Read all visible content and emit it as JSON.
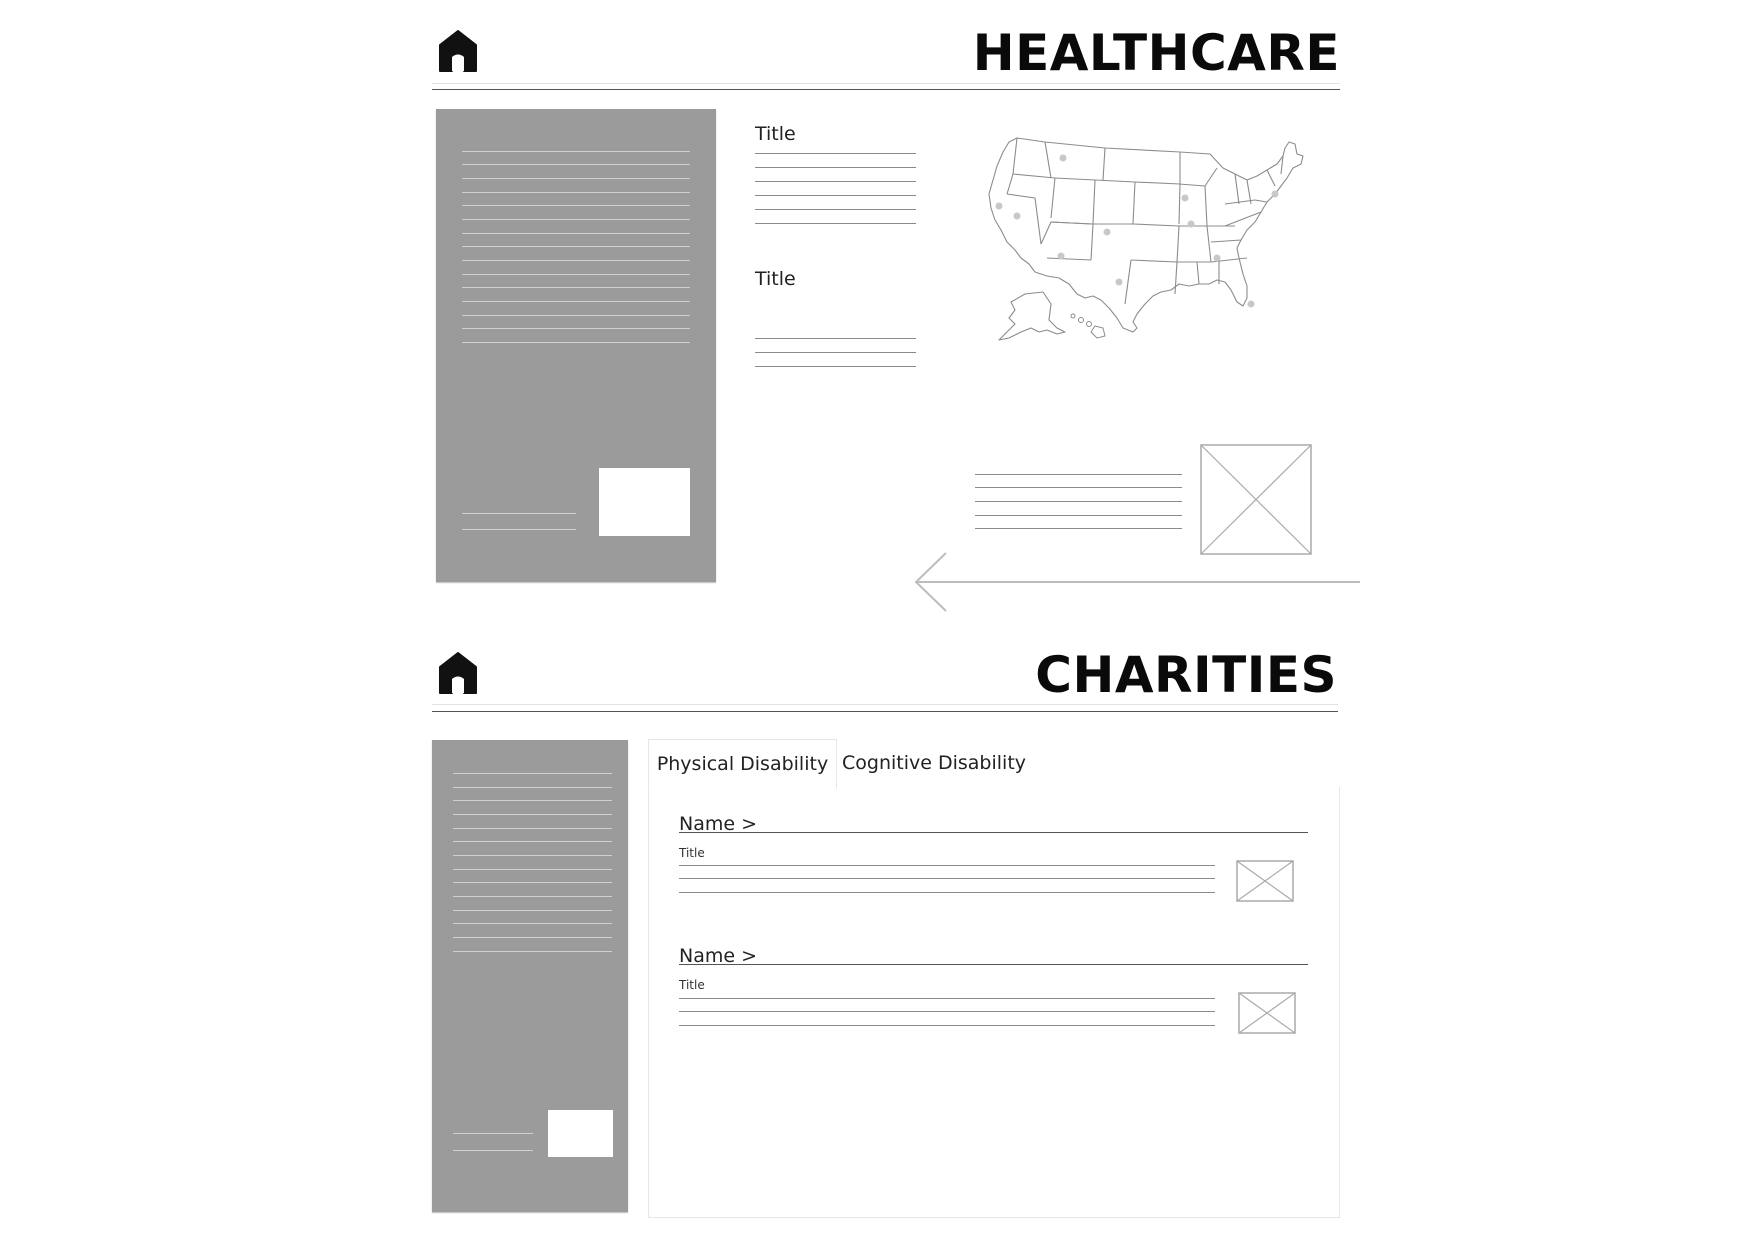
{
  "healthcare": {
    "heading": "HEALTHCARE",
    "home_icon": "home-icon",
    "blocks": [
      {
        "title": "Title"
      },
      {
        "title": "Title"
      }
    ],
    "map_icon": "usa-map",
    "image_icon": "image-placeholder-icon",
    "arrow_icon": "arrow-left-icon"
  },
  "charities": {
    "heading": "CHARITIES",
    "home_icon": "home-icon",
    "tabs": [
      {
        "label": "Physical Disability",
        "active": true
      },
      {
        "label": "Cognitive Disability",
        "active": false
      }
    ],
    "entries": [
      {
        "name": "Name >",
        "title": "Title"
      },
      {
        "name": "Name >",
        "title": "Title"
      }
    ]
  },
  "colors": {
    "panel": "#9b9b9b",
    "heading": "#0a0a0a",
    "rule": "#9a9a9a",
    "line": "#8a8a8a"
  }
}
